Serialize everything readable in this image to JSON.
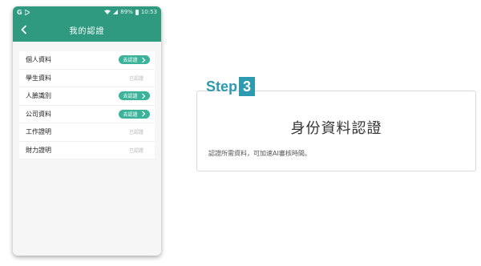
{
  "status_bar": {
    "carrier": "G",
    "battery": "89%",
    "time": "10:53"
  },
  "app_bar": {
    "title": "我的認證"
  },
  "items": [
    {
      "label": "個人資料",
      "status": "去認證",
      "action": true
    },
    {
      "label": "學生資料",
      "status": "已認證",
      "action": false
    },
    {
      "label": "人臉識別",
      "status": "去認證",
      "action": true
    },
    {
      "label": "公司資料",
      "status": "去認證",
      "action": true
    },
    {
      "label": "工作證明",
      "status": "已認證",
      "action": false
    },
    {
      "label": "財力證明",
      "status": "已認證",
      "action": false
    }
  ],
  "step": {
    "word": "Step",
    "number": "3",
    "title": "身份資料認證",
    "description": "認證所需資料，可加速AI審核時間。"
  },
  "colors": {
    "primary": "#2f9a80",
    "pill": "#3bb39a",
    "step_accent": "#2e9ab0"
  }
}
